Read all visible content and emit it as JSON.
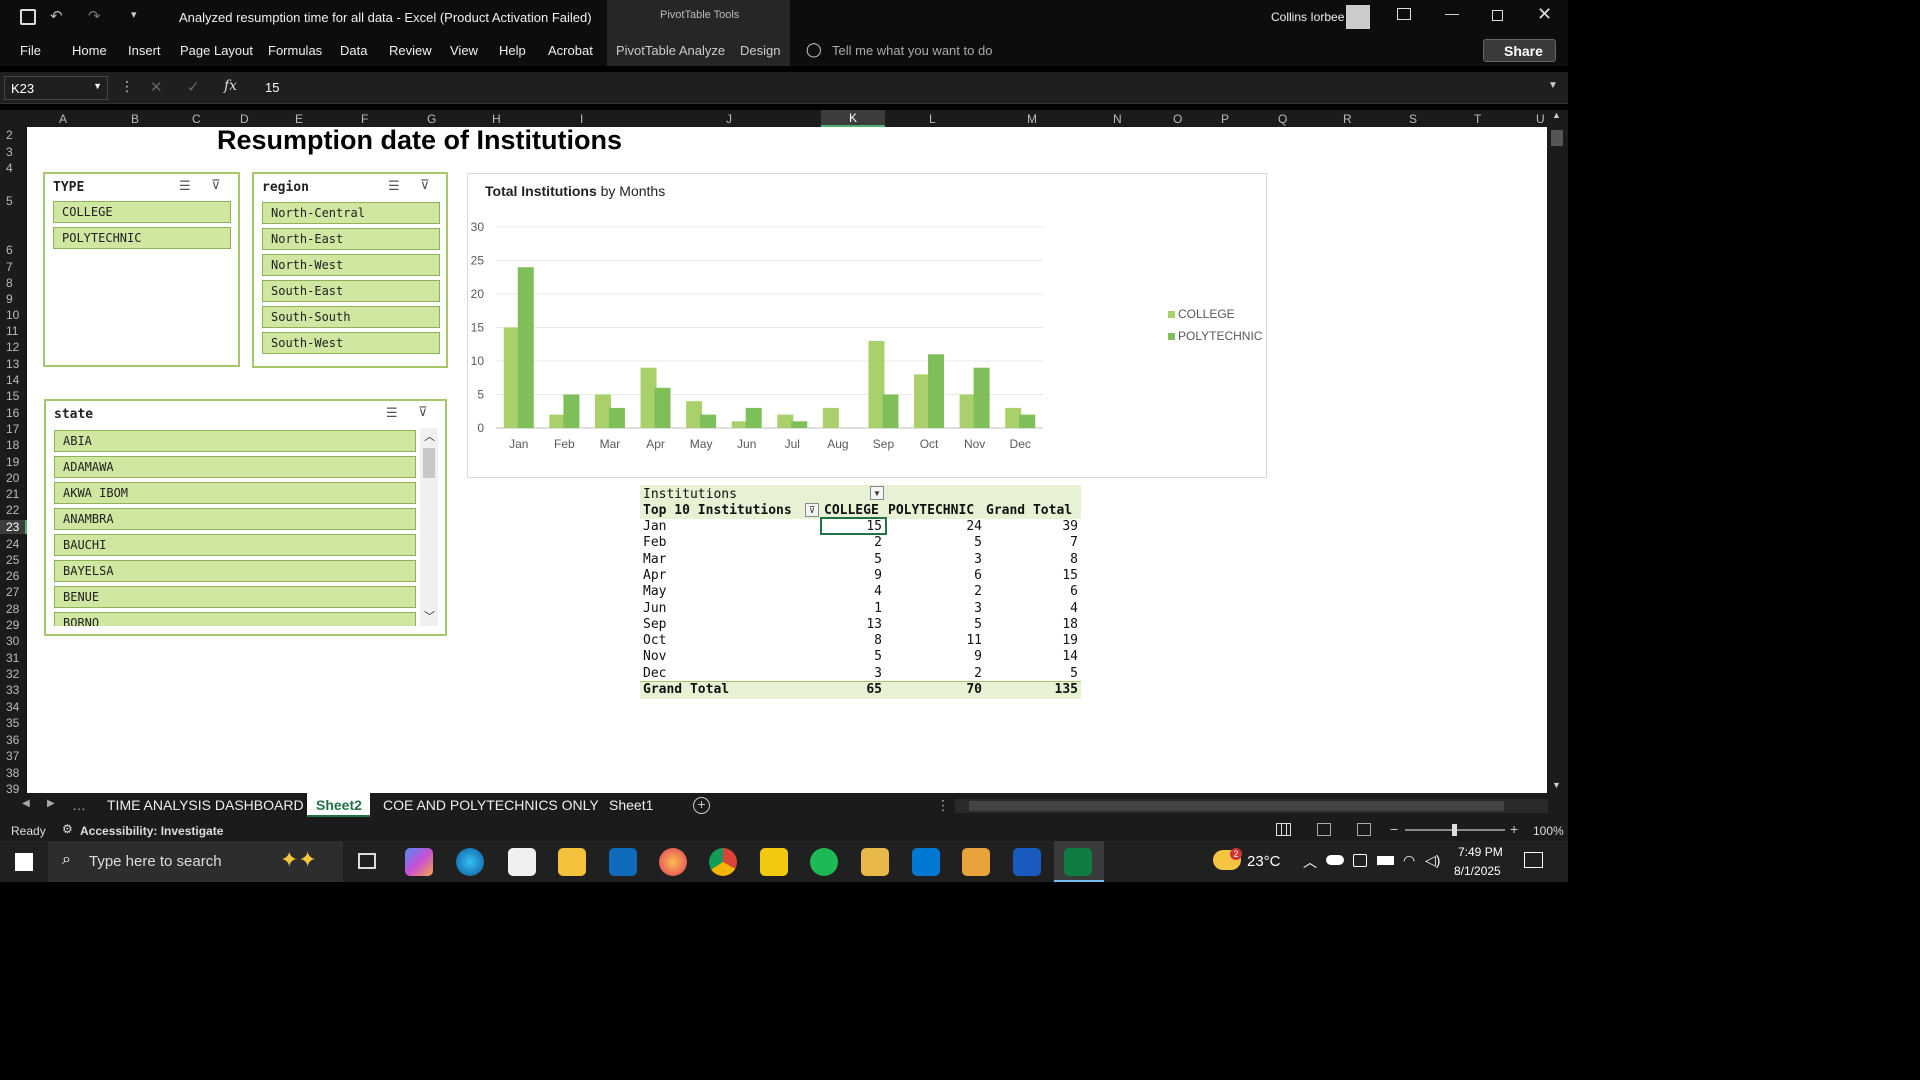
{
  "window": {
    "title": "Analyzed resumption time for all data  -  Excel (Product Activation Failed)",
    "context_tab": "PivotTable Tools",
    "user": "Collins Iorbee"
  },
  "ribbon": {
    "tabs": [
      "File",
      "Home",
      "Insert",
      "Page Layout",
      "Formulas",
      "Data",
      "Review",
      "View",
      "Help",
      "Acrobat",
      "PivotTable Analyze",
      "Design"
    ],
    "tell_me": "Tell me what you want to do",
    "share": "Share"
  },
  "formula_bar": {
    "name_box": "K23",
    "fx": "fx",
    "value": "15"
  },
  "columns": [
    "A",
    "B",
    "C",
    "D",
    "E",
    "F",
    "G",
    "H",
    "I",
    "J",
    "K",
    "L",
    "M",
    "N",
    "O",
    "P",
    "Q",
    "R",
    "S",
    "T",
    "U"
  ],
  "rows": [
    "2",
    "3",
    "4",
    "5",
    "6",
    "7",
    "8",
    "9",
    "10",
    "11",
    "12",
    "13",
    "14",
    "15",
    "16",
    "17",
    "18",
    "19",
    "20",
    "21",
    "22",
    "23",
    "24",
    "25",
    "26",
    "27",
    "28",
    "29",
    "30",
    "31",
    "32",
    "33",
    "34",
    "35",
    "36",
    "37",
    "38",
    "39"
  ],
  "sheet_title": "Resumption date of Institutions",
  "slicers": {
    "type": {
      "title": "TYPE",
      "items": [
        "COLLEGE",
        "POLYTECHNIC"
      ]
    },
    "region": {
      "title": "region",
      "items": [
        "North-Central",
        "North-East",
        "North-West",
        "South-East",
        "South-South",
        "South-West"
      ]
    },
    "state": {
      "title": "state",
      "items": [
        "ABIA",
        "ADAMAWA",
        "AKWA IBOM",
        "ANAMBRA",
        "BAUCHI",
        "BAYELSA",
        "BENUE",
        "BORNO"
      ]
    }
  },
  "chart_data": {
    "type": "bar",
    "title_bold": "Total Institutions",
    "title_rest": " by Months",
    "categories": [
      "Jan",
      "Feb",
      "Mar",
      "Apr",
      "May",
      "Jun",
      "Jul",
      "Aug",
      "Sep",
      "Oct",
      "Nov",
      "Dec"
    ],
    "series": [
      {
        "name": "COLLEGE",
        "values": [
          15,
          2,
          5,
          9,
          4,
          1,
          2,
          3,
          13,
          8,
          5,
          3
        ],
        "color": "#a9d06b"
      },
      {
        "name": "POLYTECHNIC",
        "values": [
          24,
          5,
          3,
          6,
          2,
          3,
          1,
          0,
          5,
          11,
          9,
          2
        ],
        "color": "#7fbf5a"
      }
    ],
    "yticks": [
      "0",
      "5",
      "10",
      "15",
      "20",
      "25",
      "30"
    ],
    "ylim": [
      0,
      30
    ],
    "grid": true,
    "legend": "right"
  },
  "pivot": {
    "header1": "Institutions",
    "row_label": "Top 10 Institutions",
    "columns": [
      "COLLEGE",
      "POLYTECHNIC",
      "Grand Total"
    ],
    "rows": [
      {
        "label": "Jan",
        "c": "15",
        "p": "24",
        "t": "39"
      },
      {
        "label": "Feb",
        "c": "2",
        "p": "5",
        "t": "7"
      },
      {
        "label": "Mar",
        "c": "5",
        "p": "3",
        "t": "8"
      },
      {
        "label": "Apr",
        "c": "9",
        "p": "6",
        "t": "15"
      },
      {
        "label": "May",
        "c": "4",
        "p": "2",
        "t": "6"
      },
      {
        "label": "Jun",
        "c": "1",
        "p": "3",
        "t": "4"
      },
      {
        "label": "Sep",
        "c": "13",
        "p": "5",
        "t": "18"
      },
      {
        "label": "Oct",
        "c": "8",
        "p": "11",
        "t": "19"
      },
      {
        "label": "Nov",
        "c": "5",
        "p": "9",
        "t": "14"
      },
      {
        "label": "Dec",
        "c": "3",
        "p": "2",
        "t": "5"
      }
    ],
    "total": {
      "label": "Grand Total",
      "c": "65",
      "p": "70",
      "t": "135"
    }
  },
  "sheet_tabs": [
    "TIME ANALYSIS DASHBOARD",
    "Sheet2",
    "COE AND POLYTECHNICS ONLY",
    "Sheet1"
  ],
  "active_tab": "Sheet2",
  "status": {
    "ready": "Ready",
    "accessibility": "Accessibility: Investigate",
    "zoom": "100%"
  },
  "taskbar": {
    "search": "Type here to search",
    "weather": "23°C",
    "time": "7:49 PM",
    "date": "8/1/2025",
    "weather_badge": "2"
  }
}
